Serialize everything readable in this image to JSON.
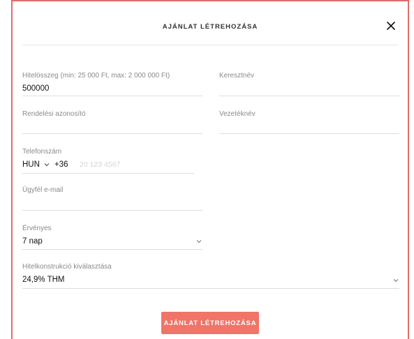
{
  "dialog": {
    "title": "AJÁNLAT LÉTREHOZÁSA",
    "close_icon": "close-icon"
  },
  "form": {
    "loan_amount": {
      "label": "Hitelösszeg (min: 25 000 Ft, max: 2 000 000 Ft)",
      "value": "500000"
    },
    "first_name": {
      "label": "Keresztnév",
      "value": ""
    },
    "order_id": {
      "label": "Rendelési azonosító",
      "value": ""
    },
    "last_name": {
      "label": "Vezetéknév",
      "value": ""
    },
    "phone": {
      "label": "Telefonszám",
      "country": "HUN",
      "prefix": "+36",
      "placeholder": "20 123 4567"
    },
    "email": {
      "label": "Ügyfél e-mail",
      "value": ""
    },
    "validity": {
      "label": "Érvényes",
      "value": "7 nap"
    },
    "loan_product": {
      "label": "Hitelkonstrukció kiválasztása",
      "value": "24,9% THM"
    }
  },
  "actions": {
    "submit_label": "AJÁNLAT LÉTREHOZÁSA"
  },
  "colors": {
    "accent": "#f07468",
    "frame_border": "#e06c6c"
  }
}
